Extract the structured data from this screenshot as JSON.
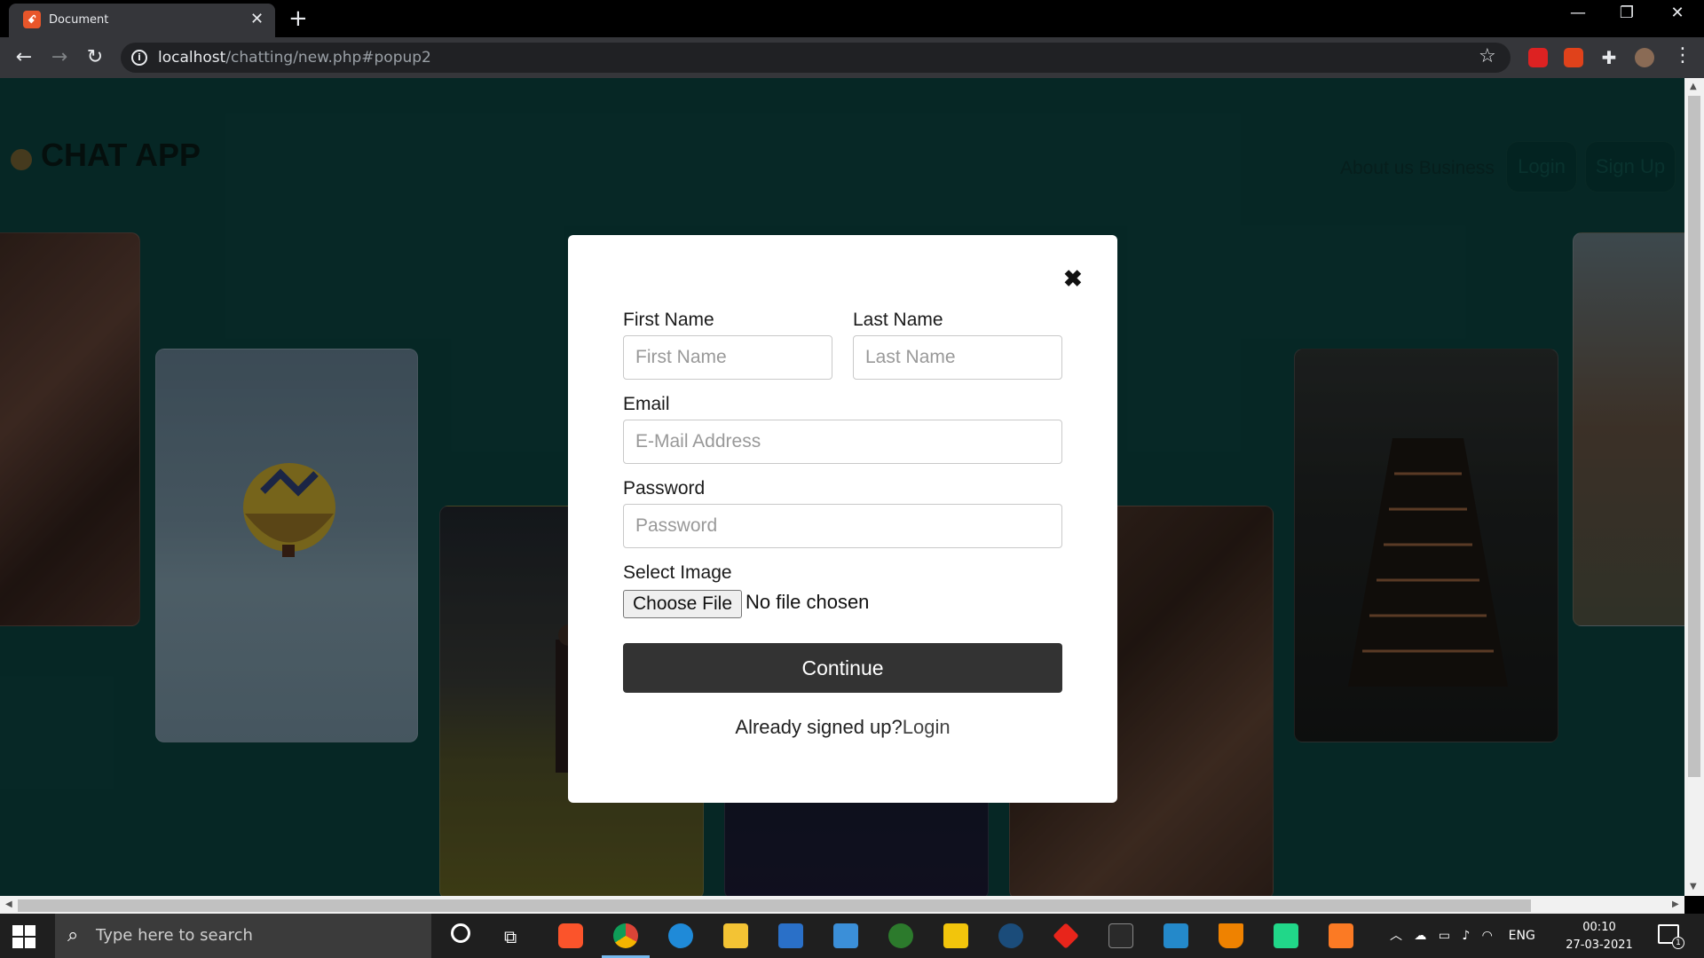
{
  "browser": {
    "tab_title": "Document",
    "tab_favicon": "xampp-icon",
    "new_tab": "+",
    "url_host": "localhost",
    "url_path": "/chatting/new.php#popup2",
    "window_min": "—",
    "window_restore": "❐",
    "window_close": "✕",
    "back": "←",
    "forward": "→",
    "reload": "↻"
  },
  "page": {
    "brand": "CHAT APP",
    "nav_about": "About us Business",
    "nav_login": "Login",
    "nav_signup": "Sign Up"
  },
  "modal": {
    "close": "✖",
    "first_name_label": "First Name",
    "first_name_placeholder": "First Name",
    "last_name_label": "Last Name",
    "last_name_placeholder": "Last Name",
    "email_label": "Email",
    "email_placeholder": "E-Mail Address",
    "password_label": "Password",
    "password_placeholder": "Password",
    "image_label": "Select Image",
    "choose_file": "Choose File",
    "no_file": "No file chosen",
    "continue": "Continue",
    "already_text": "Already signed up?",
    "login_link": "Login"
  },
  "taskbar": {
    "search_placeholder": "Type here to search",
    "tray_lang": "ENG",
    "time": "00:10",
    "date": "27-03-2021",
    "notif_count": "1"
  },
  "colors": {
    "page_bg": "#0a3d3a",
    "continue_bg": "#333333",
    "modal_bg": "#ffffff"
  }
}
